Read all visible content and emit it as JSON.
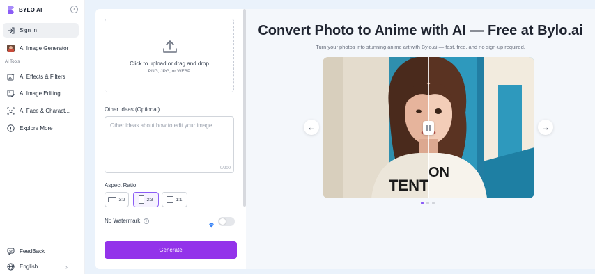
{
  "brand": {
    "name": "BYLO AI"
  },
  "sidebar": {
    "sign_in": "Sign In",
    "image_generator": "AI Image Generator",
    "section_label": "AI Tools",
    "items": [
      {
        "label": "AI Effects & Filters",
        "icon": "sparkle-image-icon"
      },
      {
        "label": "AI Image Editing...",
        "icon": "image-edit-icon"
      },
      {
        "label": "AI Face & Charact...",
        "icon": "face-scan-icon"
      },
      {
        "label": "Explore More",
        "icon": "compass-icon"
      }
    ],
    "feedback": "FeedBack",
    "language": "English"
  },
  "form": {
    "upload_title": "Click to upload or drag and drop",
    "upload_formats": "PNG, JPG, or WEBP",
    "ideas_label": "Other Ideas (Optional)",
    "ideas_placeholder": "Other ideas about how to edit your image...",
    "char_count": "0/200",
    "aspect_label": "Aspect Ratio",
    "ratios": [
      "3:2",
      "2:3",
      "1:1"
    ],
    "selected_ratio": "2:3",
    "watermark_label": "No Watermark",
    "watermark_enabled": false,
    "generate": "Generate"
  },
  "hero": {
    "title": "Convert Photo to Anime with AI — Free at Bylo.ai",
    "subtitle": "Turn your photos into stunning anime art with Bylo.ai — fast, free, and no sign-up required.",
    "prev_arrow": "←",
    "next_arrow": "→",
    "slide_count": 3,
    "active_slide": 1
  },
  "colors": {
    "accent": "#9333ea",
    "selected_border": "#8b5cf6"
  }
}
